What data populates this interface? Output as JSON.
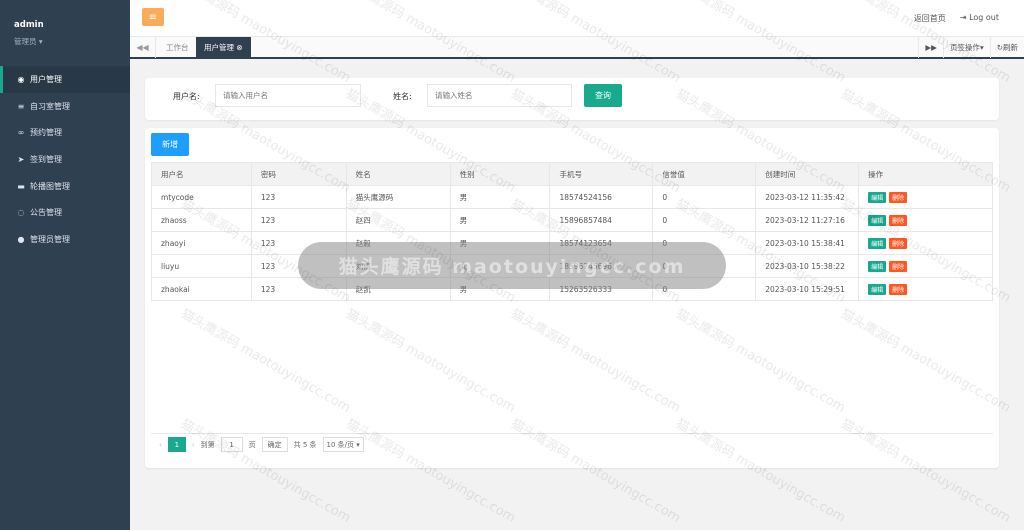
{
  "sidebar": {
    "user_name": "admin",
    "user_role": "管理员",
    "items": [
      {
        "label": "用户管理",
        "icon": "user-circle-icon",
        "glyph": "◉",
        "active": true
      },
      {
        "label": "自习室管理",
        "icon": "list-icon",
        "glyph": "≡",
        "active": false
      },
      {
        "label": "预约管理",
        "icon": "link-icon",
        "glyph": "∞",
        "active": false
      },
      {
        "label": "签到管理",
        "icon": "send-icon",
        "glyph": "➤",
        "active": false
      },
      {
        "label": "轮播图管理",
        "icon": "card-icon",
        "glyph": "▬",
        "active": false
      },
      {
        "label": "公告管理",
        "icon": "comment-icon",
        "glyph": "◌",
        "active": false
      },
      {
        "label": "管理员管理",
        "icon": "admin-icon",
        "glyph": "●",
        "active": false
      }
    ]
  },
  "topbar": {
    "home_link": "返回首页",
    "logout": "Log out"
  },
  "tabs": {
    "workbench": "工作台",
    "active_tab": "用户管理",
    "tab_ops": "页签操作",
    "refresh": "刷新"
  },
  "search": {
    "username_label": "用户名:",
    "username_placeholder": "请输入用户名",
    "name_label": "姓名:",
    "name_placeholder": "请输入姓名",
    "query_button": "查询"
  },
  "toolbar": {
    "add_button": "新增"
  },
  "table": {
    "headers": [
      "用户名",
      "密码",
      "姓名",
      "性别",
      "手机号",
      "信誉值",
      "创建时间",
      "操作"
    ],
    "rows": [
      [
        "mtycode",
        "123",
        "猫头鹰源码",
        "男",
        "18574524156",
        "0",
        "2023-03-12 11:35:42"
      ],
      [
        "zhaoss",
        "123",
        "赵四",
        "男",
        "15896857484",
        "0",
        "2023-03-12 11:27:16"
      ],
      [
        "zhaoyi",
        "123",
        "赵毅",
        "男",
        "18574123654",
        "0",
        "2023-03-10 15:38:41"
      ],
      [
        "liuyu",
        "123",
        "刘雨",
        "女",
        "18596745696",
        "0",
        "2023-03-10 15:38:22"
      ],
      [
        "zhaokai",
        "123",
        "赵凯",
        "男",
        "15263526333",
        "0",
        "2023-03-10 15:29:51"
      ]
    ],
    "edit_label": "编辑",
    "delete_label": "删除"
  },
  "pagination": {
    "current_page": "1",
    "goto_label": "到第",
    "goto_value": "1",
    "page_unit": "页",
    "confirm": "确定",
    "total": "共 5 条",
    "page_size": "10 条/页"
  },
  "overlay": {
    "watermark_text": "猫头鹰源码 maotouyingcc.com"
  },
  "colors": {
    "sidebar_bg": "#2f4050",
    "accent_green": "#19aa8d",
    "add_blue": "#1e9fff",
    "delete_orange": "#ff5722",
    "menu_orange": "#f8ac59"
  }
}
